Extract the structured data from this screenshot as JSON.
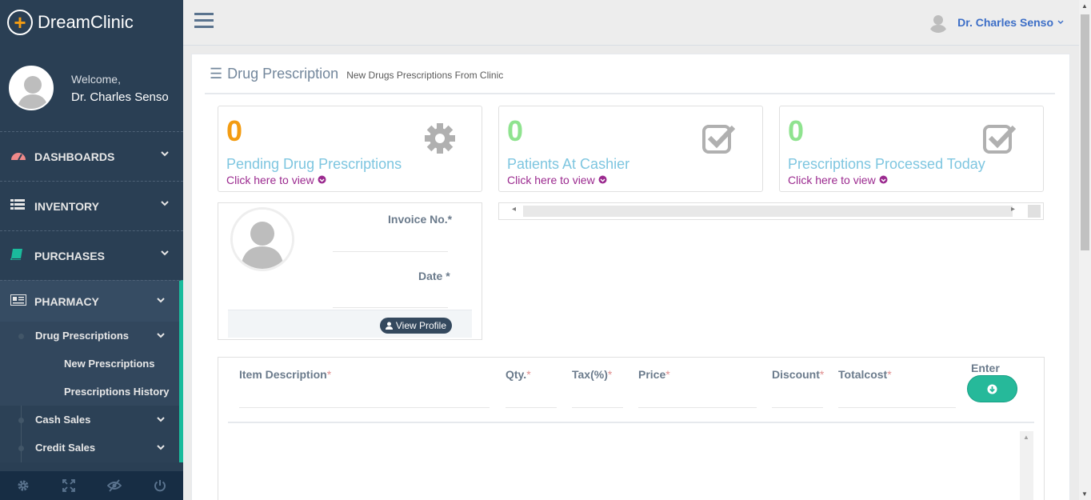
{
  "brand": {
    "name": "DreamClinic",
    "logo_icon": "plus-icon",
    "logo_color": "#f39c12"
  },
  "sidebar_profile": {
    "welcome": "Welcome,",
    "name": "Dr. Charles Senso"
  },
  "sidebar": {
    "items": [
      {
        "label": "DASHBOARDS",
        "icon": "dashboard-icon"
      },
      {
        "label": "INVENTORY",
        "icon": "list-icon"
      },
      {
        "label": "PURCHASES",
        "icon": "book-icon"
      },
      {
        "label": "PHARMACY",
        "icon": "newspaper-icon"
      }
    ],
    "pharmacy_sub": {
      "drug_prescriptions": "Drug Prescriptions",
      "new_prescriptions": "New Prescriptions",
      "prescriptions_history": "Prescriptions History",
      "cash_sales": "Cash Sales",
      "credit_sales": "Credit Sales"
    },
    "footer_icons": [
      "gear-icon",
      "fullscreen-icon",
      "eye-slash-icon",
      "power-icon"
    ]
  },
  "topnav": {
    "user_name": "Dr. Charles Senso"
  },
  "page": {
    "title": "Drug Prescription",
    "subtitle": "New Drugs Prescriptions From Clinic"
  },
  "stats": [
    {
      "count": "0",
      "label": "Pending Drug Prescriptions",
      "link": "Click here to view",
      "icon": "gear-icon",
      "count_color": "#f39c12"
    },
    {
      "count": "0",
      "label": "Patients At Cashier",
      "link": "Click here to view",
      "icon": "check-square-icon",
      "count_color": "#8fe38f"
    },
    {
      "count": "0",
      "label": "Prescriptions Processed Today",
      "link": "Click here to view",
      "icon": "check-square-icon",
      "count_color": "#8fe38f"
    }
  ],
  "profile_card": {
    "invoice_label": "Invoice No.*",
    "date_label": "Date *",
    "view_profile": "View Profile"
  },
  "items_form": {
    "columns": [
      {
        "label": "Item Description",
        "req": "*"
      },
      {
        "label": "Qty.",
        "req": "*"
      },
      {
        "label": "Tax(%)",
        "req": "*"
      },
      {
        "label": "Price",
        "req": "*"
      },
      {
        "label": "Discount",
        "req": "*"
      },
      {
        "label": "Totalcost",
        "req": "*"
      }
    ],
    "enter_label": "Enter"
  }
}
